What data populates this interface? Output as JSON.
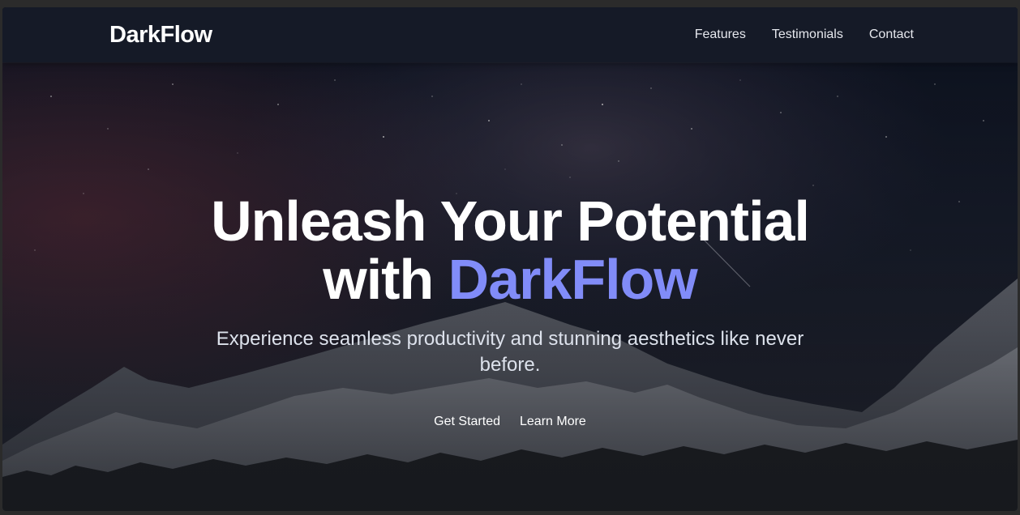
{
  "nav": {
    "brand": "DarkFlow",
    "links": [
      "Features",
      "Testimonials",
      "Contact"
    ]
  },
  "hero": {
    "headline_line1": "Unleash Your Potential",
    "headline_prefix": "with",
    "headline_accent": "DarkFlow",
    "subtitle": "Experience seamless productivity and stunning aesthetics like never before.",
    "primary_cta": "Get Started",
    "secondary_cta": "Learn More",
    "background": "starry-night-mountains-image"
  },
  "colors": {
    "accent": "#818cf8",
    "navbar": "#161b27",
    "text": "#ffffff"
  }
}
